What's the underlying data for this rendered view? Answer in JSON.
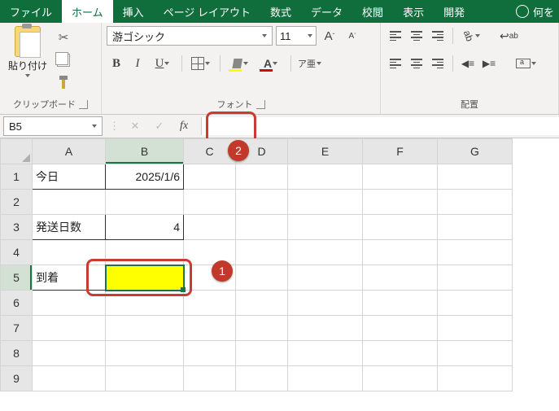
{
  "tabs": {
    "file": "ファイル",
    "home": "ホーム",
    "insert": "挿入",
    "layout": "ページ レイアウト",
    "formulas": "数式",
    "data": "データ",
    "review": "校閲",
    "view": "表示",
    "dev": "開発",
    "tell": "何を"
  },
  "clipboard": {
    "paste": "貼り付け",
    "label": "クリップボード"
  },
  "font": {
    "name": "游ゴシック",
    "size": "11",
    "label": "フォント",
    "grow": "A",
    "shrink": "A",
    "bold": "B",
    "italic": "I",
    "underline": "U",
    "color_letter": "A",
    "ruby": "ア亜"
  },
  "align": {
    "label": "配置",
    "wrap": "ab"
  },
  "namebox": {
    "ref": "B5"
  },
  "fx": "fx",
  "cols": [
    "A",
    "B",
    "C",
    "D",
    "E",
    "F",
    "G"
  ],
  "rows": [
    "1",
    "2",
    "3",
    "4",
    "5",
    "6",
    "7",
    "8",
    "9"
  ],
  "cells": {
    "A1": "今日",
    "B1": "2025/1/6",
    "A3": "発送日数",
    "B3": "4",
    "A5": "到着",
    "B5": ""
  },
  "callouts": {
    "one": "1",
    "two": "2"
  }
}
